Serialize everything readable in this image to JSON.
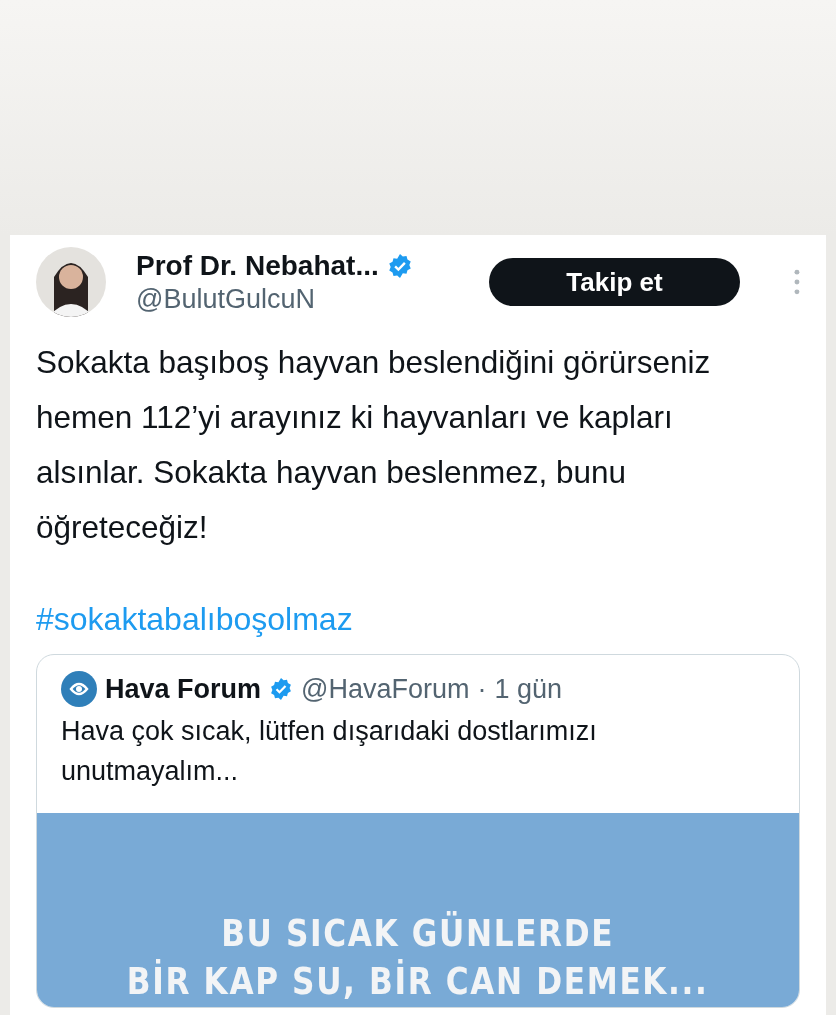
{
  "tweet": {
    "author": {
      "name": "Prof Dr. Nebahat...",
      "handle": "@BulutGulcuN",
      "verified": true
    },
    "follow_button": "Takip et",
    "text": "Sokakta başıboş hayvan beslendiğini görürseniz hemen 112’yi arayınız ki hayvanları ve kapları alsınlar. Sokakta hayvan beslenmez, bunu öğreteceğiz!",
    "hashtag": "#sokaktabalıboşolmaz",
    "quoted": {
      "name": "Hava Forum",
      "verified": true,
      "handle": "@HavaForum",
      "separator": "·",
      "time": "1 gün",
      "text": "Hava çok sıcak, lütfen dışarıdaki dostlarımızı unutmayalım...",
      "image_lines": [
        "BU SICAK GÜNLERDE",
        "BİR KAP SU, BİR CAN DEMEK..."
      ]
    }
  }
}
